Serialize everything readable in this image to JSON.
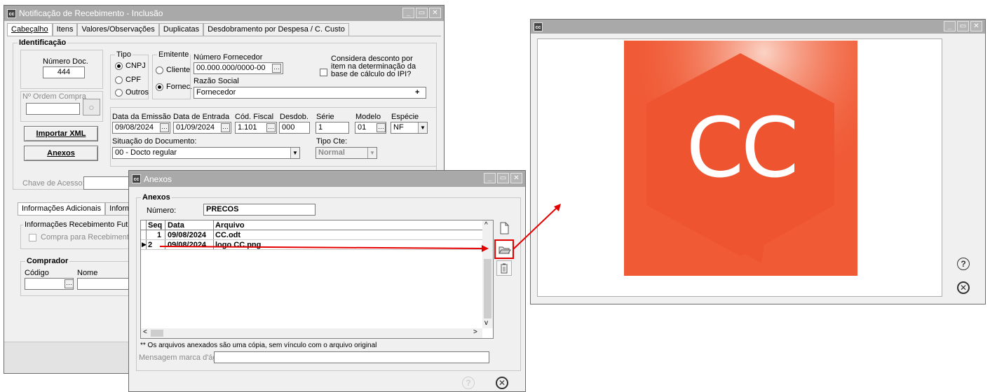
{
  "main_window": {
    "title": "Notificação de Recebimento - Inclusão",
    "tabs": [
      "Cabeçalho",
      "Itens",
      "Valores/Observações",
      "Duplicatas",
      "Desdobramento por Despesa / C. Custo"
    ],
    "identificacao_label": "Identificação",
    "numero_doc_label": "Número Doc.",
    "numero_doc_value": "444",
    "tipo_label": "Tipo",
    "tipo_options": [
      "CNPJ",
      "CPF",
      "Outros"
    ],
    "emitente_label": "Emitente",
    "emitente_options": [
      "Cliente",
      "Fornec."
    ],
    "numero_fornecedor_label": "Número Fornecedor",
    "numero_fornecedor_value": "00.000.000/0000-00",
    "considera_desconto_label": "Considera desconto por item na determinação da base de cálculo do IPI?",
    "razao_social_label": "Razão Social",
    "razao_social_value": "Fornecedor",
    "ordem_compra_label": "Nº Ordem Compra",
    "data_emissao_label": "Data da Emissão",
    "data_emissao_value": "09/08/2024",
    "data_entrada_label": "Data de Entrada",
    "data_entrada_value": "01/09/2024",
    "cod_fiscal_label": "Cód. Fiscal",
    "cod_fiscal_value": "1.101",
    "desdob_label": "Desdob.",
    "desdob_value": "000",
    "serie_label": "Série",
    "serie_value": "1",
    "modelo_label": "Modelo",
    "modelo_value": "01",
    "especie_label": "Espécie",
    "especie_value": "NF",
    "importar_xml_label": "Importar XML",
    "anexos_button_label": "Anexos",
    "situacao_label": "Situação do Documento:",
    "situacao_value": "00 - Docto regular",
    "tipo_cte_label": "Tipo Cte:",
    "tipo_cte_value": "Normal",
    "chave_acesso_label": "Chave de Acesso:",
    "bottom_tabs": [
      "Informações Adicionais",
      "Informaçõe"
    ],
    "info_receb_futuro_label": "Informações Recebimento Futuro",
    "compra_receb_futuro_label": "Compra para Recebimento Futu",
    "comprador_label": "Comprador",
    "codigo_label": "Código",
    "nome_label": "Nome"
  },
  "anexos_dialog": {
    "title": "Anexos",
    "group_label": "Anexos",
    "numero_label": "Número:",
    "numero_value": "PRECOS",
    "columns": [
      "Seq",
      "Data",
      "Arquivo"
    ],
    "rows": [
      {
        "seq": "1",
        "data": "09/08/2024",
        "arquivo": "CC.odt"
      },
      {
        "seq": "2",
        "data": "09/08/2024",
        "arquivo": "logo CC.png"
      }
    ],
    "note": "** Os arquivos anexados são uma cópia, sem vínculo com o arquivo original",
    "marca_dagua_label": "Mensagem marca d'água:"
  },
  "preview_window": {
    "logo_text": "CC",
    "logo_color": "#f05a35"
  },
  "colors": {
    "titlebar": "#a9a9a9",
    "window_bg": "#f0f0f0",
    "highlight": "#e50000",
    "logo_orange": "#f05a35"
  }
}
